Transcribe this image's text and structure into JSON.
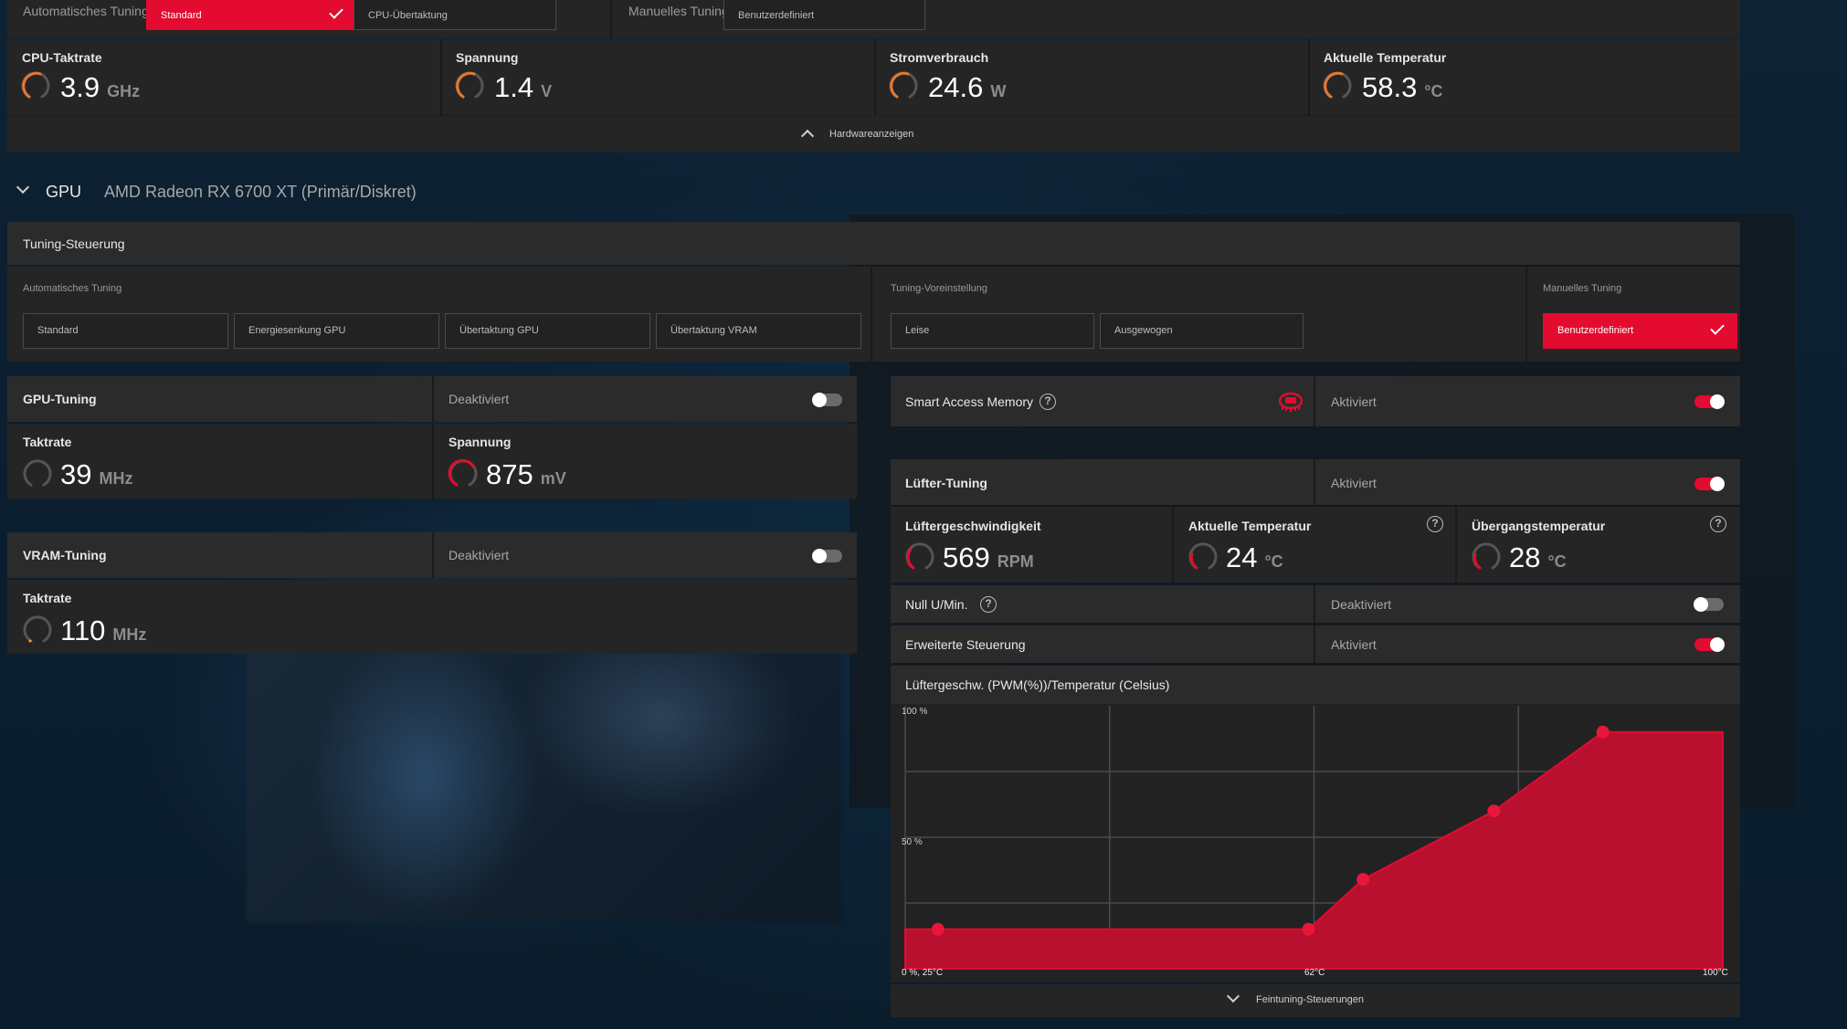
{
  "cpu": {
    "auto_tuning_label": "Automatisches Tuning",
    "preset_standard": "Standard",
    "preset_cpu_oc": "CPU-Übertaktung",
    "manual_tuning_label": "Manuelles Tuning",
    "preset_custom": "Benutzerdefiniert",
    "metrics": [
      {
        "label": "CPU-Taktrate",
        "value": "3.9",
        "unit": "GHz"
      },
      {
        "label": "Spannung",
        "value": "1.4",
        "unit": "V"
      },
      {
        "label": "Stromverbrauch",
        "value": "24.6",
        "unit": "W"
      },
      {
        "label": "Aktuelle Temperatur",
        "value": "58.3",
        "unit": "°C"
      }
    ],
    "hardware_toggle_label": "Hardwareanzeigen"
  },
  "gpu": {
    "section_label": "GPU",
    "device_name": "AMD Radeon RX 6700 XT (Primär/Diskret)",
    "tuning_control_title": "Tuning-Steuerung",
    "auto_tuning_label": "Automatisches Tuning",
    "auto_presets": [
      "Standard",
      "Energiesenkung GPU",
      "Übertaktung GPU",
      "Übertaktung VRAM"
    ],
    "tuning_preset_label": "Tuning-Voreinstellung",
    "tuning_presets": [
      "Leise",
      "Ausgewogen"
    ],
    "manual_tuning_label": "Manuelles Tuning",
    "manual_preset": "Benutzerdefiniert"
  },
  "gpu_tuning": {
    "title": "GPU-Tuning",
    "status": "Deaktiviert",
    "enabled": false,
    "clock_label": "Taktrate",
    "clock_value": "39",
    "clock_unit": "MHz",
    "voltage_label": "Spannung",
    "voltage_value": "875",
    "voltage_unit": "mV"
  },
  "vram_tuning": {
    "title": "VRAM-Tuning",
    "status": "Deaktiviert",
    "enabled": false,
    "clock_label": "Taktrate",
    "clock_value": "110",
    "clock_unit": "MHz"
  },
  "sam": {
    "label": "Smart Access Memory",
    "help": "?",
    "status": "Aktiviert",
    "enabled": true
  },
  "fan": {
    "title": "Lüfter-Tuning",
    "status": "Aktiviert",
    "enabled": true,
    "speed_label": "Lüftergeschwindigkeit",
    "speed_value": "569",
    "speed_unit": "RPM",
    "temp_label": "Aktuelle Temperatur",
    "temp_value": "24",
    "temp_unit": "°C",
    "junction_label": "Übergangstemperatur",
    "junction_value": "28",
    "junction_unit": "°C",
    "help": "?",
    "zero_rpm_label": "Null U/Min.",
    "zero_rpm_status": "Deaktiviert",
    "zero_rpm_enabled": false,
    "advanced_label": "Erweiterte Steuerung",
    "advanced_status": "Aktiviert",
    "advanced_enabled": true,
    "curve_title": "Lüftergeschw. (PWM(%))/Temperatur (Celsius)",
    "y_top_label": "100 %",
    "y_mid_label": "50 %",
    "origin_label": "0 %, 25°C",
    "x_mid_label": "62°C",
    "x_max_label": "100°C",
    "fine_tuning_label": "Feintuning-Steuerungen"
  },
  "chart_data": {
    "type": "area",
    "title": "Lüftergeschw. (PWM(%))/Temperatur (Celsius)",
    "xlabel": "",
    "ylabel": "",
    "xlim": [
      25,
      100
    ],
    "ylim": [
      0,
      100
    ],
    "grid": true,
    "series": [
      {
        "x": [
          25,
          28,
          62,
          67,
          79,
          89,
          100
        ],
        "y": [
          15,
          15,
          15,
          34,
          60,
          90,
          90
        ]
      }
    ],
    "points": [
      {
        "x": 28,
        "y": 15
      },
      {
        "x": 62,
        "y": 15
      },
      {
        "x": 67,
        "y": 34
      },
      {
        "x": 79,
        "y": 60
      },
      {
        "x": 89,
        "y": 90
      }
    ],
    "colors": {
      "fill": "#b8102e",
      "line": "#e30b2f",
      "point": "#e8173a",
      "grid": "#4a4a4a"
    }
  },
  "colors": {
    "accent": "#e30b2f",
    "panel": "#252525"
  }
}
